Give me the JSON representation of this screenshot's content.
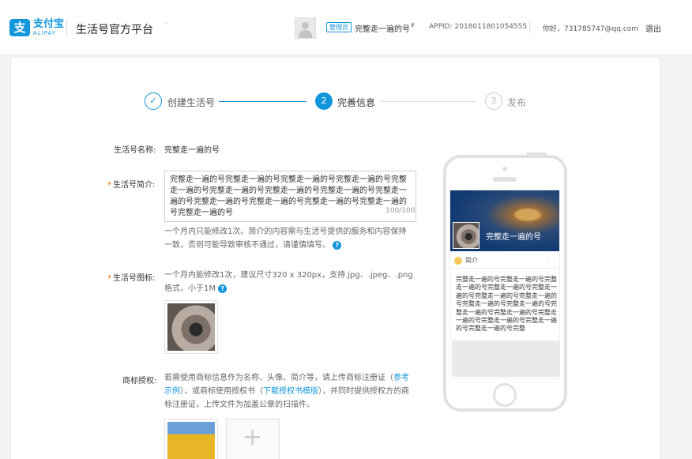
{
  "header": {
    "logo_icon": "支",
    "logo_text": "支付宝",
    "logo_subtext": "ALIPAY",
    "platform_title": "生活号官方平台",
    "platform_caret": "ˇ",
    "role_badge": "管理员",
    "account_name": "完整走一遍的号",
    "account_caret": "∨",
    "appid": "APPID: 2018011801054555",
    "greeting": "你好，731785747@qq.com",
    "logout": "退出"
  },
  "steps": [
    {
      "number": "✓",
      "label": "创建生活号",
      "state": "done"
    },
    {
      "number": "2",
      "label": "完善信息",
      "state": "active"
    },
    {
      "number": "3",
      "label": "发布",
      "state": "pending"
    }
  ],
  "form": {
    "name_label": "生活号名称:",
    "name_value": "完整走一遍的号",
    "intro_required": "*",
    "intro_label": "生活号简介:",
    "intro_value": "完整走一遍的号完整走一遍的号完整走一遍的号完整走一遍的号完整走一遍的号完整走一遍的号完整走一遍的号完整走一遍的号完整走一遍的号完整走一遍的号完整走一遍的号完整走一遍的号完整走一遍的号完整走一遍的号",
    "intro_counter": "100/100",
    "intro_help": "一个月内只能修改1次。简介的内容需与生活号提供的服务和内容保持一致，否则可能导致审核不通过，请谨慎填写。",
    "icon_required": "*",
    "icon_label": "生活号图标:",
    "icon_help": "一个月内能修改1次，建议尺寸320 x 320px，支持.jpg、.jpeg、.png格式，小于1M",
    "help_icon": "?",
    "trademark_label": "商标授权:",
    "trademark_help_1": "若需使用商标信息作为名称、头像、简介等，请上传商标注册证（",
    "trademark_link_1": "参考示例",
    "trademark_help_2": "），或商标使用授权书（",
    "trademark_link_2": "下载授权书模版",
    "trademark_help_3": "），并同时提供授权方的商标注册证，上传文件为加盖公章的扫描件。",
    "upload_plus": "+"
  },
  "preview": {
    "account_name": "完整走一遍的号",
    "intro_tab": "简介",
    "intro_caret": "›",
    "intro_text": "完整走一遍的号完整走一遍的号完整走一遍的号完整走一遍的号完整走一遍的号完整走一遍的号完整走一遍的号完整走一遍的号完整走一遍的号完整走一遍的号完整走一遍的号完整走一遍的号完整走一遍的号完整走一遍的号完整走一遍的号完整"
  },
  "colors": {
    "accent": "#1296db",
    "required": "#ff6600"
  }
}
